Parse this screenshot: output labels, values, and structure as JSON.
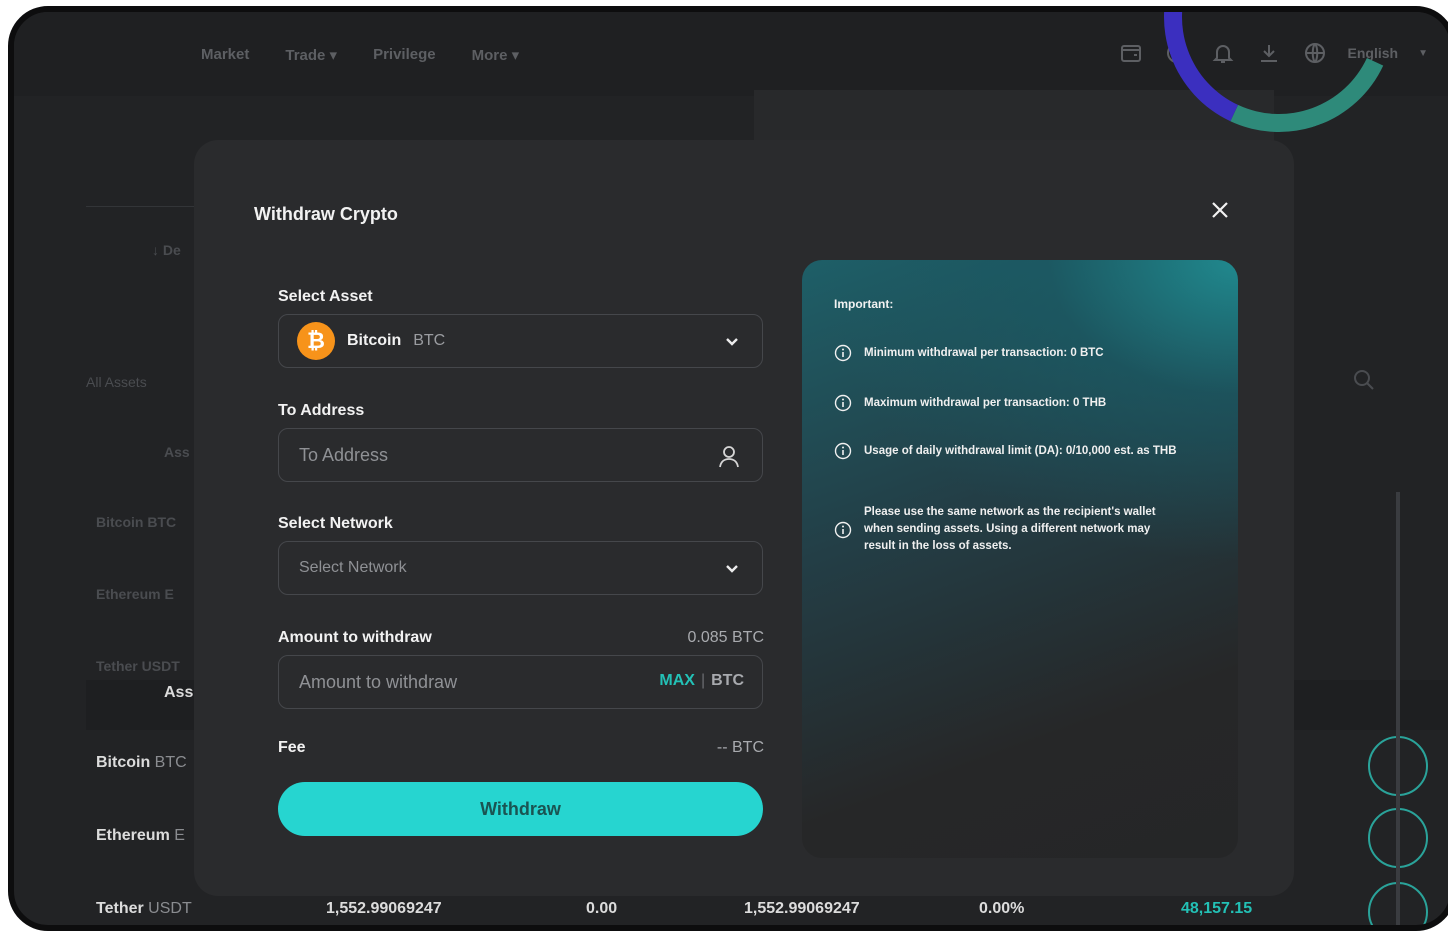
{
  "background": {
    "nav": {
      "links": [
        "Market",
        "Trade ▾",
        "Privilege",
        "More ▾"
      ],
      "language": "English"
    },
    "side_labels": {
      "deposit_hint": "↓ De",
      "all_assets": "All Assets",
      "asset_short": "Ass",
      "row_bitcoin": "Bitcoin BTC",
      "row_ethereum": "Ethereum E",
      "row_tether": "Tether USDT"
    },
    "table": {
      "header_asset": "Ass",
      "rows": [
        {
          "name": "Bitcoin",
          "symbol": "BTC"
        },
        {
          "name": "Ethereum",
          "symbol": "E"
        },
        {
          "name": "Tether",
          "symbol": "USDT",
          "total": "1,552.99069247",
          "in_order": "0.00",
          "available": "1,552.99069247",
          "change": "0.00%",
          "value": "48,157.15"
        }
      ]
    }
  },
  "modal": {
    "title": "Withdraw Crypto",
    "select_asset": {
      "label": "Select Asset",
      "asset_name": "Bitcoin",
      "asset_symbol": "BTC",
      "logo_glyph": "₿"
    },
    "to_address": {
      "label": "To Address",
      "placeholder": "To Address"
    },
    "select_network": {
      "label": "Select Network",
      "placeholder": "Select Network"
    },
    "amount": {
      "label": "Amount to withdraw",
      "available": "0.085 BTC",
      "placeholder": "Amount to withdraw",
      "max_label": "MAX",
      "separator": "|",
      "unit": "BTC"
    },
    "fee": {
      "label": "Fee",
      "value": "-- BTC"
    },
    "withdraw_button": "Withdraw",
    "info": {
      "title": "Important:",
      "items": [
        "Minimum withdrawal per transaction: 0 BTC",
        "Maximum withdrawal per transaction: 0 THB",
        "Usage of daily withdrawal limit (DA): 0/10,000 est. as THB",
        "Please use the same network as the recipient's wallet when sending assets. Using a different network may result in the loss of assets."
      ]
    }
  },
  "colors": {
    "accent": "#26d5d0",
    "accent_text": "#23c1b6",
    "bitcoin": "#f7931a",
    "panel": "#2a2b2d",
    "background": "#222325"
  },
  "icons": [
    "close-icon",
    "chevron-down-icon",
    "user-icon",
    "info-icon",
    "bitcoin-icon",
    "search-icon",
    "wallet-icon",
    "history-icon",
    "bell-icon",
    "download-icon",
    "globe-icon"
  ]
}
